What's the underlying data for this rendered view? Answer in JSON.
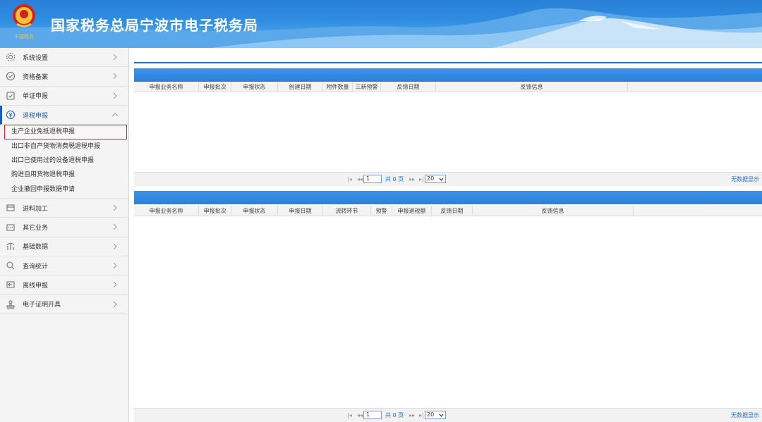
{
  "header": {
    "title": "国家税务总局宁波市电子税务局"
  },
  "sidebar": {
    "items": [
      {
        "label": "系统设置",
        "icon": "gear-icon"
      },
      {
        "label": "资格备案",
        "icon": "shield-check-icon"
      },
      {
        "label": "单证申报",
        "icon": "document-check-icon"
      },
      {
        "label": "退税申报",
        "icon": "refund-icon"
      },
      {
        "label": "进料加工",
        "icon": "box-icon"
      },
      {
        "label": "其它业务",
        "icon": "ellipsis-box-icon"
      },
      {
        "label": "基础数据",
        "icon": "bar-chart-icon"
      },
      {
        "label": "查询统计",
        "icon": "search-icon"
      },
      {
        "label": "离线申报",
        "icon": "offline-icon"
      },
      {
        "label": "电子证明开具",
        "icon": "stamp-icon"
      }
    ],
    "sub_items": [
      "生产企业免抵退税申报",
      "出口非自产货物消费税退税申报",
      "出口已使用过的设备退税申报",
      "购进自用货物退税申报",
      "企业撤回申报数据申请"
    ]
  },
  "grid1": {
    "columns": [
      "申报业务名称",
      "申报批次",
      "申报状态",
      "创建日期",
      "附件数量",
      "三新预警",
      "反馈日期",
      "反馈信息"
    ],
    "pager": {
      "page": "1",
      "info": "共 0 页",
      "size": "20",
      "empty": "无数据显示"
    }
  },
  "grid2": {
    "columns": [
      "申报业务名称",
      "申报批次",
      "申报状态",
      "申报日期",
      "流转环节",
      "预警",
      "申报退税额",
      "反馈日期",
      "反馈信息"
    ],
    "pager": {
      "page": "1",
      "info": "共 0 页",
      "size": "20",
      "empty": "无数据显示"
    }
  },
  "colors": {
    "accent": "#1f6fd1",
    "header": "#2f8fe2",
    "active_border": "#e02424"
  }
}
